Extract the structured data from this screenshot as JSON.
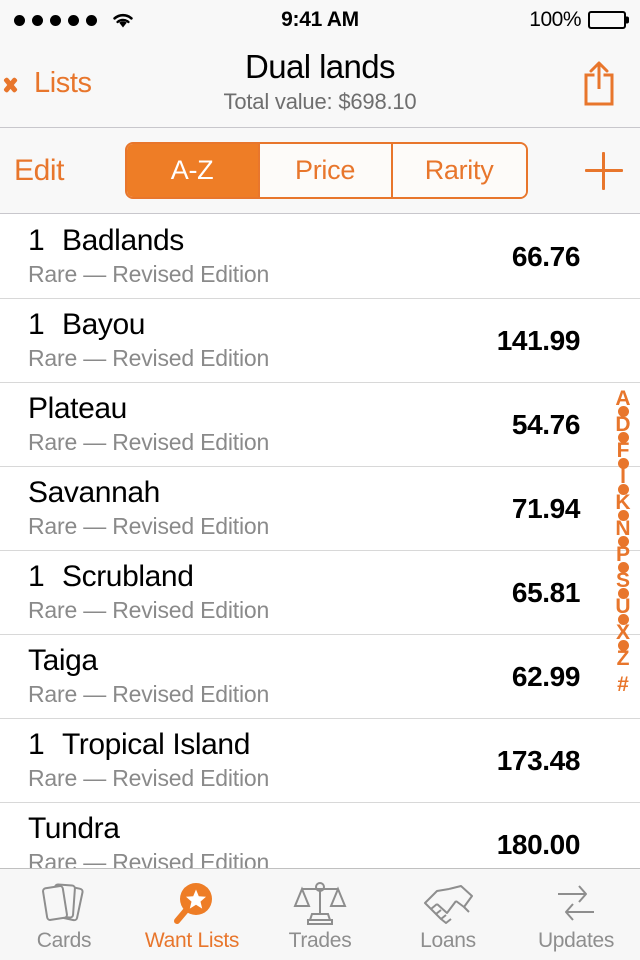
{
  "status_bar": {
    "signal_dots": 5,
    "wifi_icon": "wifi-icon",
    "time": "9:41 AM",
    "battery_percent": "100%",
    "battery_icon": "battery-full-icon"
  },
  "nav_bar": {
    "back_label": "Lists",
    "back_icon": "chevron-left-icon",
    "title": "Dual lands",
    "subtitle": "Total value: $698.10",
    "share_icon": "share-icon"
  },
  "toolbar": {
    "edit_label": "Edit",
    "add_icon": "plus-icon",
    "segments": [
      {
        "label": "A-Z",
        "active": true
      },
      {
        "label": "Price",
        "active": false
      },
      {
        "label": "Rarity",
        "active": false
      }
    ]
  },
  "list": {
    "rows": [
      {
        "qty": "1",
        "name": "Badlands",
        "subtitle": "Rare — Revised Edition",
        "price": "66.76"
      },
      {
        "qty": "1",
        "name": "Bayou",
        "subtitle": "Rare — Revised Edition",
        "price": "141.99"
      },
      {
        "qty": "",
        "name": "Plateau",
        "subtitle": "Rare — Revised Edition",
        "price": "54.76"
      },
      {
        "qty": "",
        "name": "Savannah",
        "subtitle": "Rare — Revised Edition",
        "price": "71.94"
      },
      {
        "qty": "1",
        "name": "Scrubland",
        "subtitle": "Rare — Revised Edition",
        "price": "65.81"
      },
      {
        "qty": "",
        "name": "Taiga",
        "subtitle": "Rare — Revised Edition",
        "price": "62.99"
      },
      {
        "qty": "1",
        "name": "Tropical Island",
        "subtitle": "Rare — Revised Edition",
        "price": "173.48"
      },
      {
        "qty": "",
        "name": "Tundra",
        "subtitle": "Rare — Revised Edition",
        "price": "180.00"
      }
    ]
  },
  "index_bar": {
    "entries": [
      "A",
      "•",
      "D",
      "•",
      "F",
      "•",
      "I",
      "•",
      "K",
      "•",
      "N",
      "•",
      "P",
      "•",
      "S",
      "•",
      "U",
      "•",
      "X",
      "•",
      "Z",
      "#"
    ]
  },
  "tab_bar": {
    "tabs": [
      {
        "label": "Cards",
        "icon": "cards-stack-icon",
        "active": false
      },
      {
        "label": "Want Lists",
        "icon": "magnifier-star-icon",
        "active": true
      },
      {
        "label": "Trades",
        "icon": "balance-scales-icon",
        "active": false
      },
      {
        "label": "Loans",
        "icon": "handshake-icon",
        "active": false
      },
      {
        "label": "Updates",
        "icon": "refresh-arrows-icon",
        "active": false
      }
    ]
  },
  "colors": {
    "accent": "#E8762C",
    "segment_active_fill": "#EE7D26",
    "bar_background": "#F8F8F8",
    "separator": "#D8D8D8",
    "subtitle_text": "#8A8A8A",
    "tab_inactive": "#8E8E8E"
  }
}
